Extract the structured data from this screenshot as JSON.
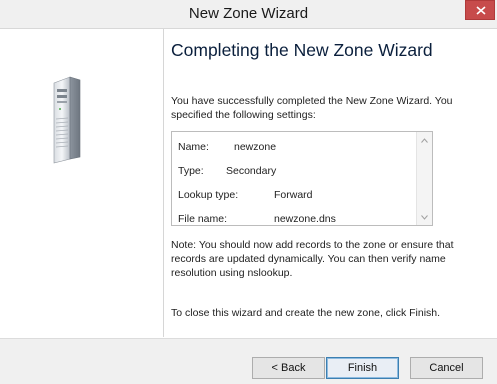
{
  "window": {
    "title": "New Zone Wizard",
    "close_glyph": "close-icon"
  },
  "page": {
    "heading": "Completing the New Zone Wizard",
    "intro": "You have successfully completed the New Zone Wizard. You specified the following settings:",
    "settings": [
      {
        "label": "Name:",
        "value": "newzone"
      },
      {
        "label": "Type:",
        "value": "Secondary"
      },
      {
        "label": "Lookup type:",
        "value": "Forward"
      },
      {
        "label": "File name:",
        "value": "newzone.dns"
      }
    ],
    "scroll_up": "^",
    "scroll_down": "v",
    "note": "Note: You should now add records to the zone or ensure that records are updated dynamically. You can then verify name resolution using nslookup.",
    "closing": "To close this wizard and create the new zone, click Finish."
  },
  "buttons": {
    "back": "< Back",
    "finish": "Finish",
    "cancel": "Cancel"
  },
  "colors": {
    "close_button": "#c74b4b",
    "heading": "#0a1f3c",
    "default_button_border": "#3c7fb1"
  }
}
